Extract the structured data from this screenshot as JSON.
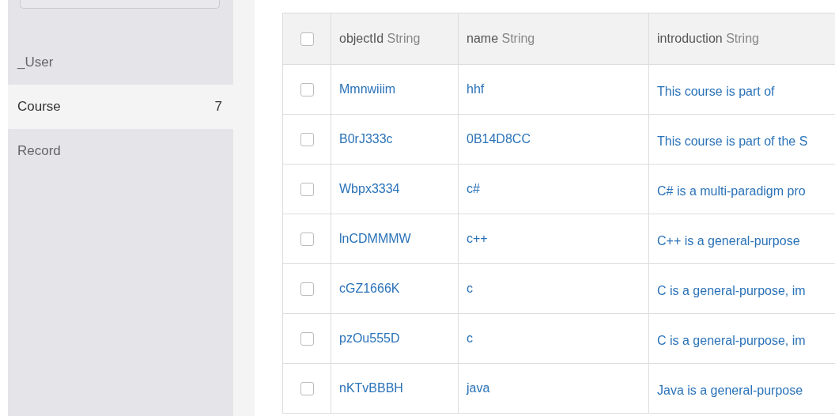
{
  "sidebar": {
    "items": [
      {
        "label": "_User",
        "selected": false
      },
      {
        "label": "Course",
        "count": "7",
        "selected": true
      },
      {
        "label": "Record",
        "selected": false
      }
    ]
  },
  "table": {
    "select_all": {
      "checked": false
    },
    "columns": [
      {
        "name": "objectId",
        "type": "String"
      },
      {
        "name": "name",
        "type": "String"
      },
      {
        "name": "introduction",
        "type": "String"
      }
    ],
    "rows": [
      {
        "checked": false,
        "cells": [
          "Mmnwiiim",
          "hhf",
          "This course is part of"
        ]
      },
      {
        "checked": false,
        "cells": [
          "B0rJ333c",
          "0B14D8CC",
          "This course is part of the S"
        ]
      },
      {
        "checked": false,
        "cells": [
          "Wbpx3334",
          "c#",
          "C# is a multi-paradigm pro"
        ]
      },
      {
        "checked": false,
        "cells": [
          "lnCDMMMW",
          "c++",
          "C++ is a general-purpose"
        ]
      },
      {
        "checked": false,
        "cells": [
          "cGZ1666K",
          "c",
          "C is a general-purpose, im"
        ]
      },
      {
        "checked": false,
        "cells": [
          "pzOu555D",
          "c",
          "C is a general-purpose, im"
        ]
      },
      {
        "checked": false,
        "cells": [
          "nKTvBBBH",
          "java",
          "Java is a general-purpose"
        ]
      }
    ]
  }
}
